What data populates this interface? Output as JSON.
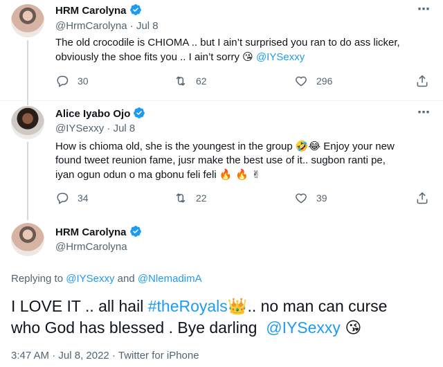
{
  "tweets": [
    {
      "name": "HRM Carolyna",
      "handle": "@HrmCarolyna",
      "date": "Jul 8",
      "text_line1": "The old crocodile is CHIOMA .. but I ain’t surprised you ran to do ass licker,",
      "text_line2": "obviously the shoe fits you .. I ain’t sorry",
      "emoji_end": "😘",
      "mention": "@IYSexxy",
      "replies": "30",
      "retweets": "62",
      "likes": "296"
    },
    {
      "name": "Alice Iyabo Ojo",
      "handle": "@IYSexxy",
      "date": "Jul 8",
      "text_line1a": "How is chioma old, she is the youngest in the group",
      "emoji_mid": "🤣😂",
      "text_line1b": "Enjoy your new",
      "text_line2": "found tweet reunion fame, jusr make the best use of it.. sugbon ranti pe,",
      "text_line3": "iyan ogun odun o ma gbonu feli feli",
      "emoji_end": "🔥 🔥 ✌",
      "replies": "34",
      "retweets": "22",
      "likes": "39"
    }
  ],
  "main": {
    "name": "HRM Carolyna",
    "handle": "@HrmCarolyna",
    "replying_prefix": "Replying to",
    "reply_mention1": "@IYSexxy",
    "reply_and": "and",
    "reply_mention2": "@NlemadimA",
    "text_a": "I LOVE IT .. all hail",
    "hashtag": "#theRoyals",
    "crown": "👑",
    "text_b": ".. no man can curse",
    "text_line2": "who God has blessed . Bye darling",
    "mention": "@IYSexxy",
    "emoji_end": "😘",
    "time": "3:47 AM",
    "sep": "·",
    "full_date": "Jul 8, 2022",
    "source": "Twitter for iPhone"
  },
  "icons": {
    "more": "⋯"
  },
  "colors": {
    "accent": "#1d9bf0",
    "secondary": "#536471",
    "text": "#0f1419",
    "thread_line": "#cfd9de"
  }
}
